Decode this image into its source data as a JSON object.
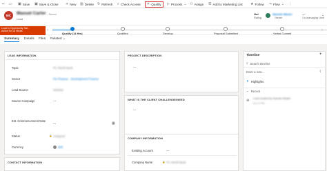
{
  "command_bar": {
    "items": [
      {
        "icon": "←",
        "label": ""
      },
      {
        "icon": "▭",
        "label": ""
      },
      {
        "icon": "💾",
        "label": "Save"
      },
      {
        "icon": "💾",
        "label": "Save & Close"
      },
      {
        "icon": "+",
        "label": "New"
      },
      {
        "icon": "🗑",
        "label": "Delete"
      },
      {
        "icon": "↻",
        "label": "Refresh"
      },
      {
        "icon": "🔍",
        "label": "Check Access"
      },
      {
        "icon": "✔",
        "label": "Qualify"
      },
      {
        "icon": "▷",
        "label": "Process"
      },
      {
        "icon": "👤",
        "label": "Assign"
      },
      {
        "icon": "☰",
        "label": "Add to Marketing List"
      },
      {
        "icon": "★",
        "label": "Follow"
      },
      {
        "icon": "⚡",
        "label": "Flow"
      }
    ],
    "highlighted_color": "#e0393e"
  },
  "header": {
    "avatar_initials": "MC",
    "record_name": "Maxuel Carler",
    "saved_status": "- Saved",
    "record_type": "Lead",
    "rating_value": "Hot",
    "rating_label": "Rating",
    "owner_name": "Hannah Wasler",
    "owner_label": "Owner",
    "marketing_value": "---",
    "marketing_label": "Co-managing Limit"
  },
  "process": {
    "flag_line1": "Lead to Opportunity Sal...",
    "flag_line2": "Active for 14 Hours",
    "stages": [
      {
        "label": "Qualify  (14 Hrs)",
        "active": true
      },
      {
        "label": "Qualified",
        "active": false
      },
      {
        "label": "Develop",
        "active": false
      },
      {
        "label": "Proposal Submitted",
        "active": false
      },
      {
        "label": "Verbal Commit",
        "active": false
      }
    ],
    "accent": "#0078d4",
    "flag_color": "#d83b01"
  },
  "tabs": [
    "Summary",
    "Details",
    "Files",
    "Related ⌄"
  ],
  "lead_info": {
    "title": "LEAD INFORMATION",
    "fields": [
      {
        "label": "Topic",
        "value": "PC World Bank"
      },
      {
        "label": "Sector",
        "value": "Fin Finance · Development Finance"
      },
      {
        "label": "Lead Source",
        "value": "Website"
      },
      {
        "label": "Source Campaign",
        "value": "---"
      },
      {
        "label": "Est. Commencement Date",
        "value": "---"
      },
      {
        "label": "Status",
        "value": "Assigned"
      },
      {
        "label": "Currency",
        "value": "INR"
      }
    ]
  },
  "contact_info": {
    "title": "CONTACT INFORMATION"
  },
  "project": {
    "title": "PROJECT DESCRIPTION",
    "value": "---",
    "challenge_title": "WHAT IS THE CLIENT CHALLENGE/NEED",
    "challenge_value": "---"
  },
  "company": {
    "title": "COMPANY INFORMATION",
    "fields": [
      {
        "label": "Existing Account",
        "value": "---"
      },
      {
        "label": "Company Name",
        "value": "PC World Bank"
      }
    ]
  },
  "timeline": {
    "title": "Timeline",
    "search_placeholder": "Search timeline",
    "note_placeholder": "Enter a note...",
    "highlights": "Highlights",
    "recent": "Recent",
    "entry_text": "Lead created by Hannah Wasler",
    "entry_time": "01:17 PM"
  }
}
